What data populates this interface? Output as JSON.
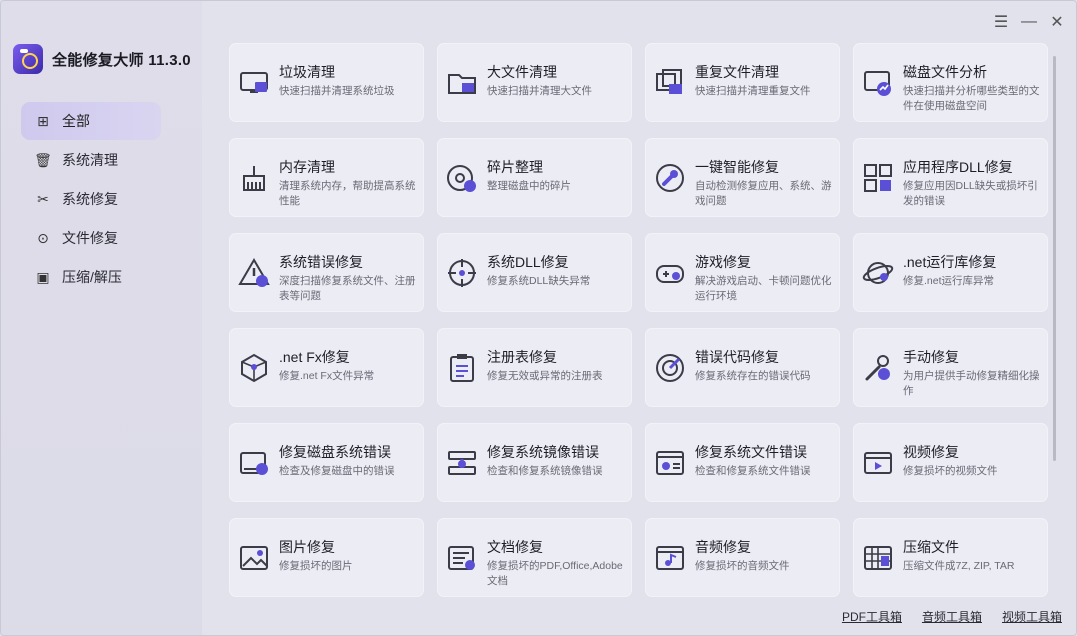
{
  "app": {
    "title": "全能修复大师 11.3.0"
  },
  "window_controls": {
    "menu": "☰",
    "minimize": "—",
    "close": "✕"
  },
  "sidebar": {
    "items": [
      {
        "label": "全部",
        "icon": "grid-icon",
        "glyph": "⊞"
      },
      {
        "label": "系统清理",
        "icon": "broom-icon",
        "glyph": "🗑"
      },
      {
        "label": "系统修复",
        "icon": "tools-icon",
        "glyph": "✂"
      },
      {
        "label": "文件修复",
        "icon": "file-search-icon",
        "glyph": "⊙"
      },
      {
        "label": "压缩/解压",
        "icon": "archive-icon",
        "glyph": "▣"
      }
    ]
  },
  "cards": [
    {
      "title": "垃圾清理",
      "desc": "快速扫描并清理系统垃圾",
      "icon": "monitor-clean-icon"
    },
    {
      "title": "大文件清理",
      "desc": "快速扫描并清理大文件",
      "icon": "folder-clean-icon"
    },
    {
      "title": "重复文件清理",
      "desc": "快速扫描并清理重复文件",
      "icon": "duplicate-files-icon"
    },
    {
      "title": "磁盘文件分析",
      "desc": "快速扫描并分析哪些类型的文件在使用磁盘空间",
      "icon": "disk-analysis-icon"
    },
    {
      "title": "内存清理",
      "desc": "清理系统内存，帮助提高系统性能",
      "icon": "memory-broom-icon"
    },
    {
      "title": "碎片整理",
      "desc": "整理磁盘中的碎片",
      "icon": "defrag-disc-icon"
    },
    {
      "title": "一键智能修复",
      "desc": "自动检测修复应用、系统、游戏问题",
      "icon": "wrench-circle-icon"
    },
    {
      "title": "应用程序DLL修复",
      "desc": "修复应用因DLL缺失或损坏引发的错误",
      "icon": "app-grid-icon"
    },
    {
      "title": "系统错误修复",
      "desc": "深度扫描修复系统文件、注册表等问题",
      "icon": "warning-icon"
    },
    {
      "title": "系统DLL修复",
      "desc": "修复系统DLL缺失异常",
      "icon": "crosshair-icon"
    },
    {
      "title": "游戏修复",
      "desc": "解决游戏启动、卡顿问题优化运行环境",
      "icon": "gamepad-icon"
    },
    {
      "title": ".net运行库修复",
      "desc": "修复.net运行库异常",
      "icon": "planet-icon"
    },
    {
      "title": ".net Fx修复",
      "desc": "修复.net Fx文件异常",
      "icon": "cube-icon"
    },
    {
      "title": "注册表修复",
      "desc": "修复无效或异常的注册表",
      "icon": "clipboard-icon"
    },
    {
      "title": "错误代码修复",
      "desc": "修复系统存在的错误代码",
      "icon": "target-icon"
    },
    {
      "title": "手动修复",
      "desc": "为用户提供手动修复精细化操作",
      "icon": "wrench-gear-icon"
    },
    {
      "title": "修复磁盘系统错误",
      "desc": "检查及修复磁盘中的错误",
      "icon": "disk-warning-icon"
    },
    {
      "title": "修复系统镜像错误",
      "desc": "检查和修复系统镜像错误",
      "icon": "image-drive-icon"
    },
    {
      "title": "修复系统文件错误",
      "desc": "检查和修复系统文件错误",
      "icon": "system-file-icon"
    },
    {
      "title": "视频修复",
      "desc": "修复损坏的视频文件",
      "icon": "video-icon"
    },
    {
      "title": "图片修复",
      "desc": "修复损坏的图片",
      "icon": "picture-icon"
    },
    {
      "title": "文档修复",
      "desc": "修复损坏的PDF,Office,Adobe文档",
      "icon": "document-icon"
    },
    {
      "title": "音频修复",
      "desc": "修复损坏的音频文件",
      "icon": "audio-icon"
    },
    {
      "title": "压缩文件",
      "desc": "压缩文件成7Z, ZIP, TAR",
      "icon": "zip-icon"
    }
  ],
  "footer": {
    "links": [
      "PDF工具箱",
      "音频工具箱",
      "视频工具箱"
    ]
  },
  "colors": {
    "accent": "#6a4fe0",
    "sidebar_active": "#d3cdef"
  }
}
